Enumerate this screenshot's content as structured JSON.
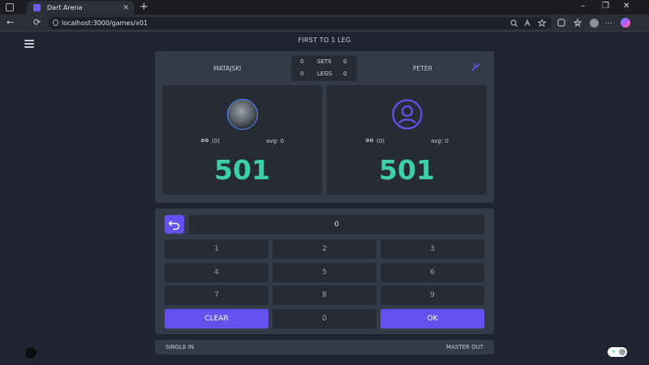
{
  "browser": {
    "tab_title": "Dart Arena",
    "tab_close": "✕",
    "new_tab": "+",
    "url": "localhost:3000/games/x01",
    "window_controls": [
      "–",
      "❐",
      "✕"
    ],
    "nav": [
      "←",
      "⟳"
    ],
    "more": "…"
  },
  "game": {
    "mode_title": "FIRST TO 1 LEG",
    "player1": {
      "name": "MATAJSKI",
      "sets": "0",
      "legs": "0",
      "team": "(0)",
      "avg": "avg: 0",
      "score": "501"
    },
    "player2": {
      "name": "PETER",
      "sets": "0",
      "legs": "0",
      "team": "(0)",
      "avg": "avg: 0",
      "score": "501"
    },
    "sets_label": "SETS",
    "legs_label": "LEGS"
  },
  "keypad": {
    "display": "0",
    "keys": [
      "1",
      "2",
      "3",
      "4",
      "5",
      "6",
      "7",
      "8",
      "9"
    ],
    "clear": "CLEAR",
    "zero": "0",
    "ok": "OK"
  },
  "footer": {
    "in_mode": "SINGLE IN",
    "out_mode": "MASTER OUT"
  },
  "colors": {
    "accent": "#6651f0",
    "score": "#3ccfa8",
    "background": "#1f2430",
    "card": "#333a48"
  }
}
